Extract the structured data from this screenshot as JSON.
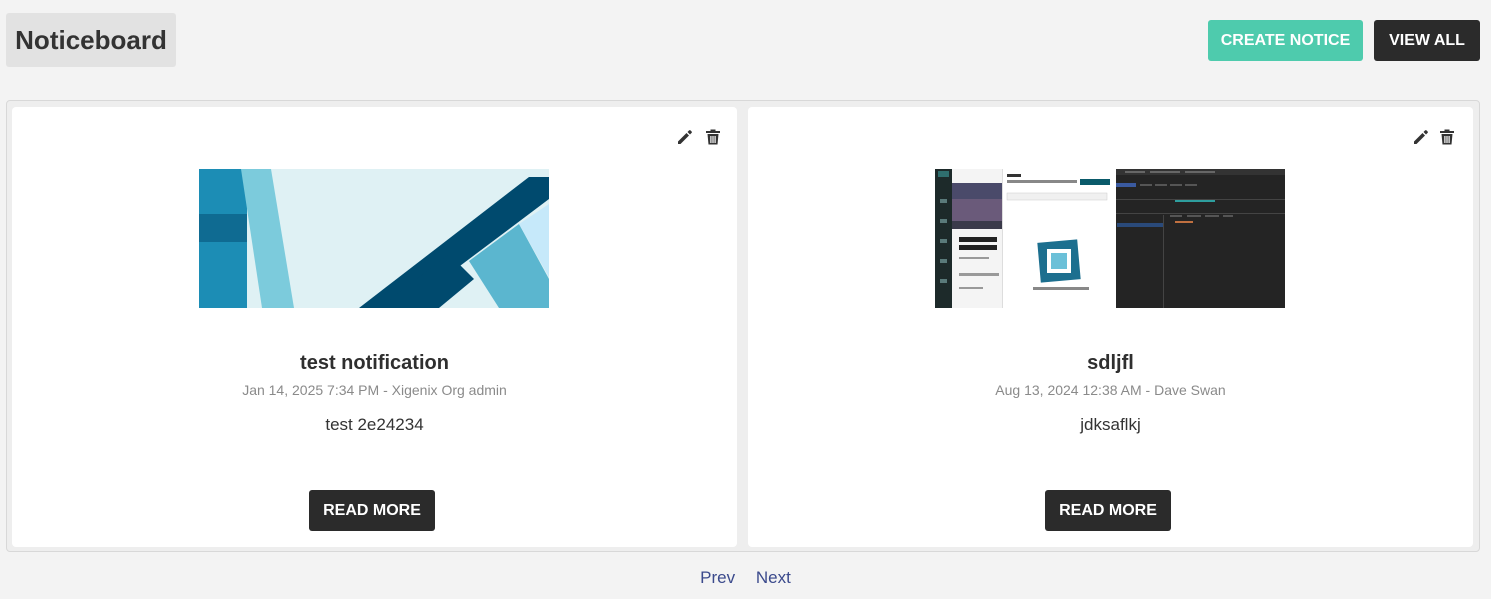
{
  "header": {
    "title": "Noticeboard",
    "create_label": "CREATE NOTICE",
    "view_all_label": "VIEW ALL"
  },
  "notices": [
    {
      "title": "test notification",
      "date": "Jan 14, 2025 7:34 PM",
      "author": "Xigenix Org admin",
      "body": "test 2e24234",
      "read_more_label": "READ MORE",
      "image": "abstract-blue-geometric"
    },
    {
      "title": "sdljfl",
      "date": "Aug 13, 2024 12:38 AM",
      "author": "Dave Swan",
      "body": "jdksaflkj",
      "read_more_label": "READ MORE",
      "image": "app-screenshot"
    }
  ],
  "pagination": {
    "prev_label": "Prev",
    "next_label": "Next"
  },
  "colors": {
    "accent": "#4ecbad",
    "dark_button": "#2b2b2b",
    "link": "#3b4a8c"
  }
}
